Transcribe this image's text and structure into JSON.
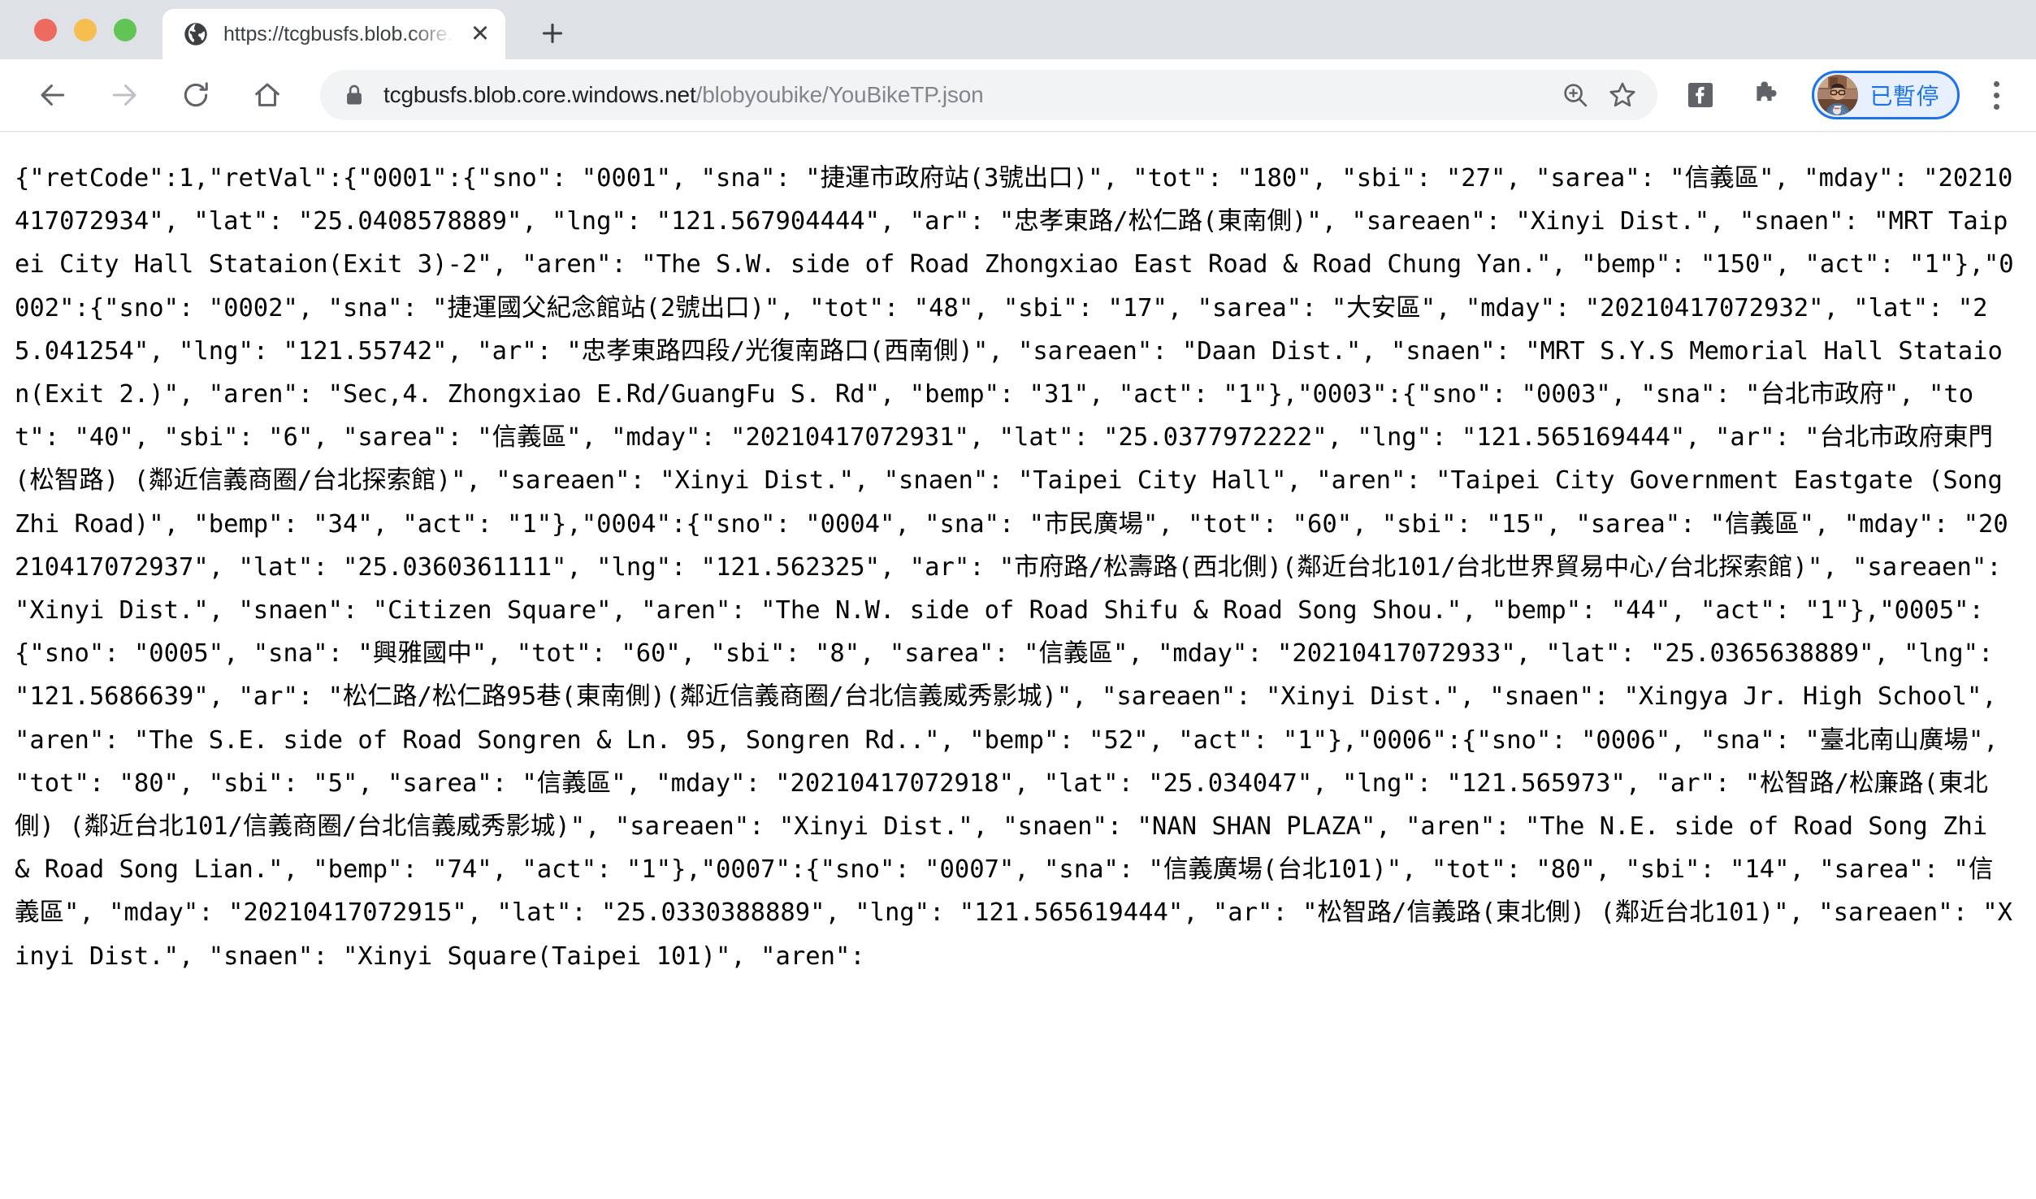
{
  "window": {
    "traffic_lights": [
      "close",
      "minimize",
      "maximize"
    ]
  },
  "tabstrip": {
    "tab": {
      "title": "https://tcgbusfs.blob.core.wind",
      "favicon": "globe-icon",
      "close_label": "✕"
    },
    "new_tab_label": "+"
  },
  "toolbar": {
    "back_label": "←",
    "forward_label": "→",
    "reload_label": "⟳",
    "home_label": "⌂",
    "omnibox": {
      "lock_icon": "lock-icon",
      "url_domain": "tcgbusfs.blob.core.windows.net",
      "url_path": "/blobyoubike/YouBikeTP.json",
      "zoom_icon": "zoom-in-icon",
      "star_icon": "star-icon"
    },
    "facebook_icon": "facebook-icon",
    "extensions_icon": "puzzle-icon",
    "profile": {
      "label": "已暫停",
      "avatar": "user-avatar"
    },
    "menu_icon": "three-dot-menu-icon"
  },
  "page": {
    "content_type": "json",
    "body": "{\"retCode\":1,\"retVal\":{\"0001\":{\"sno\": \"0001\", \"sna\": \"捷運市政府站(3號出口)\", \"tot\": \"180\", \"sbi\": \"27\", \"sarea\": \"信義區\", \"mday\": \"20210417072934\", \"lat\": \"25.0408578889\", \"lng\": \"121.567904444\", \"ar\": \"忠孝東路/松仁路(東南側)\", \"sareaen\": \"Xinyi Dist.\", \"snaen\": \"MRT Taipei City Hall Stataion(Exit 3)-2\", \"aren\": \"The S.W. side of Road Zhongxiao East Road & Road Chung Yan.\", \"bemp\": \"150\", \"act\": \"1\"},\"0002\":{\"sno\": \"0002\", \"sna\": \"捷運國父紀念館站(2號出口)\", \"tot\": \"48\", \"sbi\": \"17\", \"sarea\": \"大安區\", \"mday\": \"20210417072932\", \"lat\": \"25.041254\", \"lng\": \"121.55742\", \"ar\": \"忠孝東路四段/光復南路口(西南側)\", \"sareaen\": \"Daan Dist.\", \"snaen\": \"MRT S.Y.S Memorial Hall Stataion(Exit 2.)\", \"aren\": \"Sec,4. Zhongxiao E.Rd/GuangFu S. Rd\", \"bemp\": \"31\", \"act\": \"1\"},\"0003\":{\"sno\": \"0003\", \"sna\": \"台北市政府\", \"tot\": \"40\", \"sbi\": \"6\", \"sarea\": \"信義區\", \"mday\": \"20210417072931\", \"lat\": \"25.0377972222\", \"lng\": \"121.565169444\", \"ar\": \"台北市政府東門(松智路) (鄰近信義商圈/台北探索館)\", \"sareaen\": \"Xinyi Dist.\", \"snaen\": \"Taipei City Hall\", \"aren\": \"Taipei City Government Eastgate (Song Zhi Road)\", \"bemp\": \"34\", \"act\": \"1\"},\"0004\":{\"sno\": \"0004\", \"sna\": \"市民廣場\", \"tot\": \"60\", \"sbi\": \"15\", \"sarea\": \"信義區\", \"mday\": \"20210417072937\", \"lat\": \"25.0360361111\", \"lng\": \"121.562325\", \"ar\": \"市府路/松壽路(西北側)(鄰近台北101/台北世界貿易中心/台北探索館)\", \"sareaen\": \"Xinyi Dist.\", \"snaen\": \"Citizen Square\", \"aren\": \"The N.W. side of Road Shifu & Road Song Shou.\", \"bemp\": \"44\", \"act\": \"1\"},\"0005\":{\"sno\": \"0005\", \"sna\": \"興雅國中\", \"tot\": \"60\", \"sbi\": \"8\", \"sarea\": \"信義區\", \"mday\": \"20210417072933\", \"lat\": \"25.0365638889\", \"lng\": \"121.5686639\", \"ar\": \"松仁路/松仁路95巷(東南側)(鄰近信義商圈/台北信義威秀影城)\", \"sareaen\": \"Xinyi Dist.\", \"snaen\": \"Xingya Jr. High School\", \"aren\": \"The S.E. side of Road Songren & Ln. 95, Songren Rd..\", \"bemp\": \"52\", \"act\": \"1\"},\"0006\":{\"sno\": \"0006\", \"sna\": \"臺北南山廣場\", \"tot\": \"80\", \"sbi\": \"5\", \"sarea\": \"信義區\", \"mday\": \"20210417072918\", \"lat\": \"25.034047\", \"lng\": \"121.565973\", \"ar\": \"松智路/松廉路(東北側) (鄰近台北101/信義商圈/台北信義威秀影城)\", \"sareaen\": \"Xinyi Dist.\", \"snaen\": \"NAN SHAN PLAZA\", \"aren\": \"The N.E. side of Road Song Zhi & Road Song Lian.\", \"bemp\": \"74\", \"act\": \"1\"},\"0007\":{\"sno\": \"0007\", \"sna\": \"信義廣場(台北101)\", \"tot\": \"80\", \"sbi\": \"14\", \"sarea\": \"信義區\", \"mday\": \"20210417072915\", \"lat\": \"25.0330388889\", \"lng\": \"121.565619444\", \"ar\": \"松智路/信義路(東北側) (鄰近台北101)\", \"sareaen\": \"Xinyi Dist.\", \"snaen\": \"Xinyi Square(Taipei 101)\", \"aren\":"
  },
  "colors": {
    "tabstrip_bg": "#dee1e6",
    "toolbar_bg": "#ffffff",
    "omnibox_bg": "#f1f3f4",
    "accent_blue": "#1a73e8",
    "profile_pill_bg": "#e8f0fe",
    "text_primary": "#202124",
    "text_secondary": "#80868b"
  }
}
